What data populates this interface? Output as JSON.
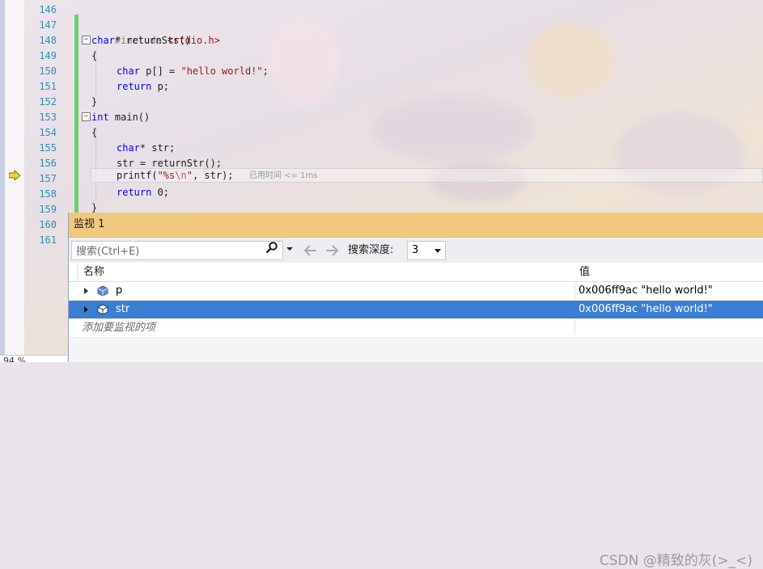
{
  "editor": {
    "line_numbers": [
      "146",
      "147",
      "148",
      "149",
      "150",
      "151",
      "152",
      "153",
      "154",
      "155",
      "156",
      "157",
      "158",
      "159",
      "160",
      "161"
    ],
    "perf_tip": "已用时间 <= 1ms",
    "zoom": "94 %"
  },
  "code": {
    "l147": {
      "directive": "#include",
      "header": "<stdio.h>"
    },
    "l148": {
      "kw": "char",
      "rest": "* returnStr()"
    },
    "l149": {
      "text": "{"
    },
    "l150": {
      "kw": "char",
      "mid": " p[] = ",
      "str": "\"hello world!\"",
      "end": ";"
    },
    "l151": {
      "kw": "return",
      "rest": " p;"
    },
    "l152": {
      "text": "}"
    },
    "l153": {
      "kw": "int",
      "rest": " main()"
    },
    "l154": {
      "text": "{"
    },
    "l155": {
      "kw": "char",
      "rest": "* str;"
    },
    "l156": {
      "text": "str = returnStr();"
    },
    "l157": {
      "fn": "printf(",
      "str_a": "\"%s",
      "esc": "\\n",
      "str_b": "\"",
      "rest": ", str);"
    },
    "l158": {
      "kw": "return",
      "rest": " 0;"
    },
    "l159": {
      "text": "}"
    }
  },
  "watch": {
    "title": "监视 1",
    "search_placeholder": "搜索(Ctrl+E)",
    "depth_label": "搜索深度:",
    "depth_value": "3",
    "col_name": "名称",
    "col_value": "值",
    "rows": [
      {
        "name": "p",
        "value": "0x006ff9ac \"hello world!\""
      },
      {
        "name": "str",
        "value": "0x006ff9ac \"hello world!\""
      }
    ],
    "add_item": "添加要监视的项"
  },
  "watermark": "CSDN @精致的灰(>_<)",
  "colors": {
    "title_bar": "#f0c97f",
    "selection": "#3a7fd4",
    "keyword": "#0000ff",
    "string": "#a31515",
    "line_number": "#2b91af",
    "change_bar": "#6bd06b"
  },
  "icons": {
    "instruction_pointer": "yellow-arrow-icon",
    "search": "magnifier-icon",
    "variable": "cube-icon"
  }
}
